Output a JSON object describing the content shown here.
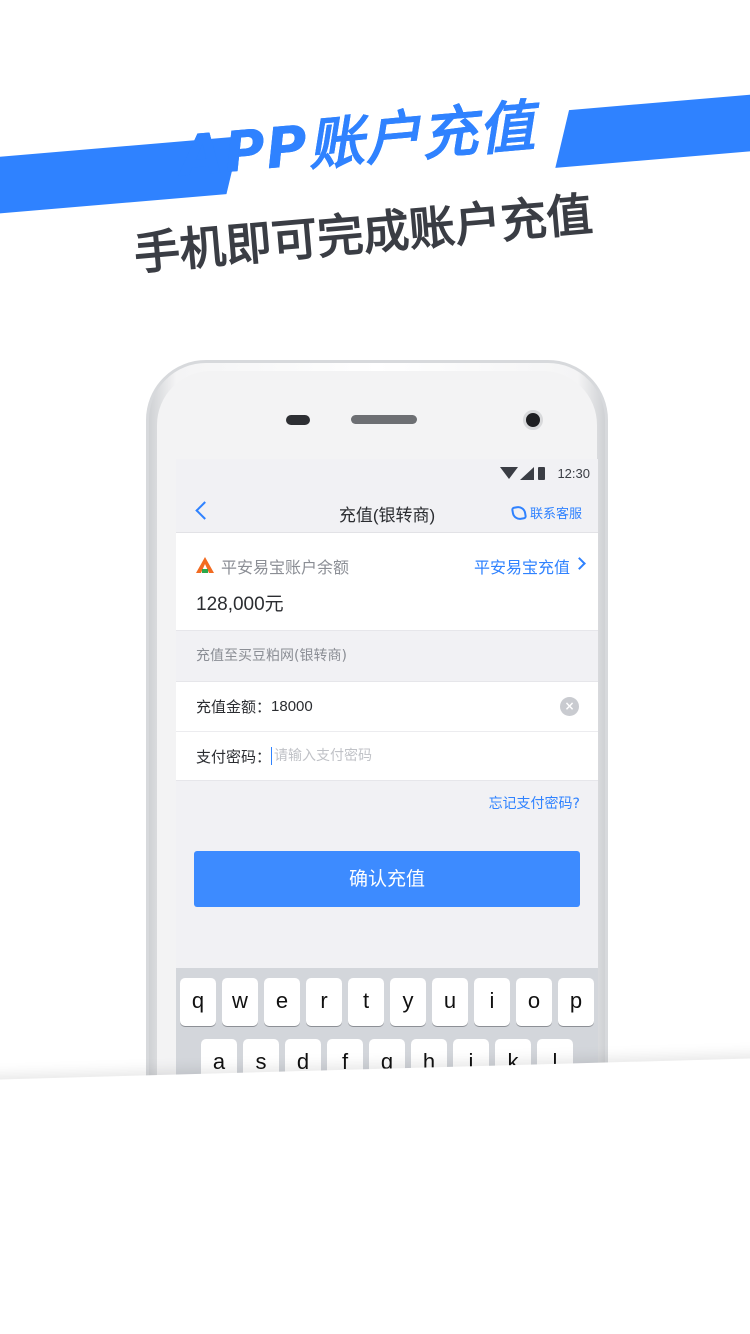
{
  "banner": {
    "headline": "APP账户充值",
    "subline": "手机即可完成账户充值",
    "accent_color": "#2f82ff"
  },
  "status_bar": {
    "time": "12:30"
  },
  "nav": {
    "title": "充值(银转商)",
    "contact_label": "联系客服"
  },
  "account_card": {
    "label": "平安易宝账户余额",
    "link_label": "平安易宝充值",
    "balance": "128,000元"
  },
  "section_title": "充值至买豆粕网(银转商)",
  "form": {
    "amount_label": "充值金额：",
    "amount_value": "18000",
    "password_label": "支付密码：",
    "password_placeholder": "请输入支付密码"
  },
  "forgot_password": "忘记支付密码?",
  "confirm_button": "确认充值",
  "keyboard": {
    "row1": [
      "q",
      "w",
      "e",
      "r",
      "t",
      "y",
      "u",
      "i",
      "o",
      "p"
    ],
    "row2": [
      "a",
      "s",
      "d",
      "f",
      "g",
      "h",
      "j",
      "k",
      "l"
    ]
  }
}
